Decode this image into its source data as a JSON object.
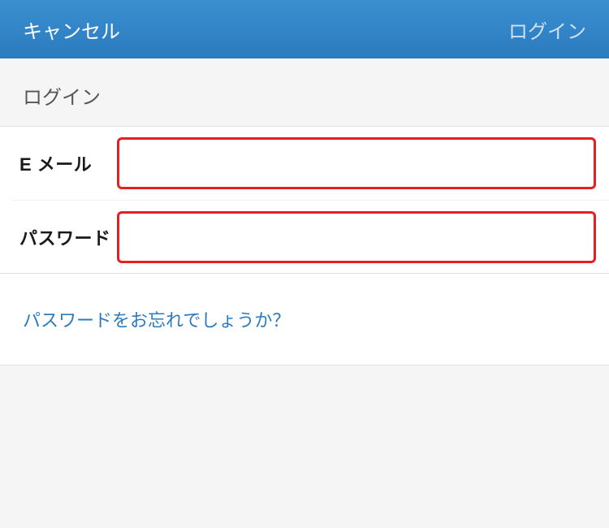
{
  "navbar": {
    "cancel_label": "キャンセル",
    "login_label": "ログイン"
  },
  "section": {
    "title": "ログイン"
  },
  "form": {
    "email_label": "E メール",
    "email_value": "",
    "password_label": "パスワード",
    "password_value": ""
  },
  "links": {
    "forgot_password": "パスワードをお忘れでしょうか？"
  },
  "colors": {
    "navbar_bg": "#2b7bbf",
    "error_border": "#e62020",
    "link": "#2b7bbf"
  }
}
